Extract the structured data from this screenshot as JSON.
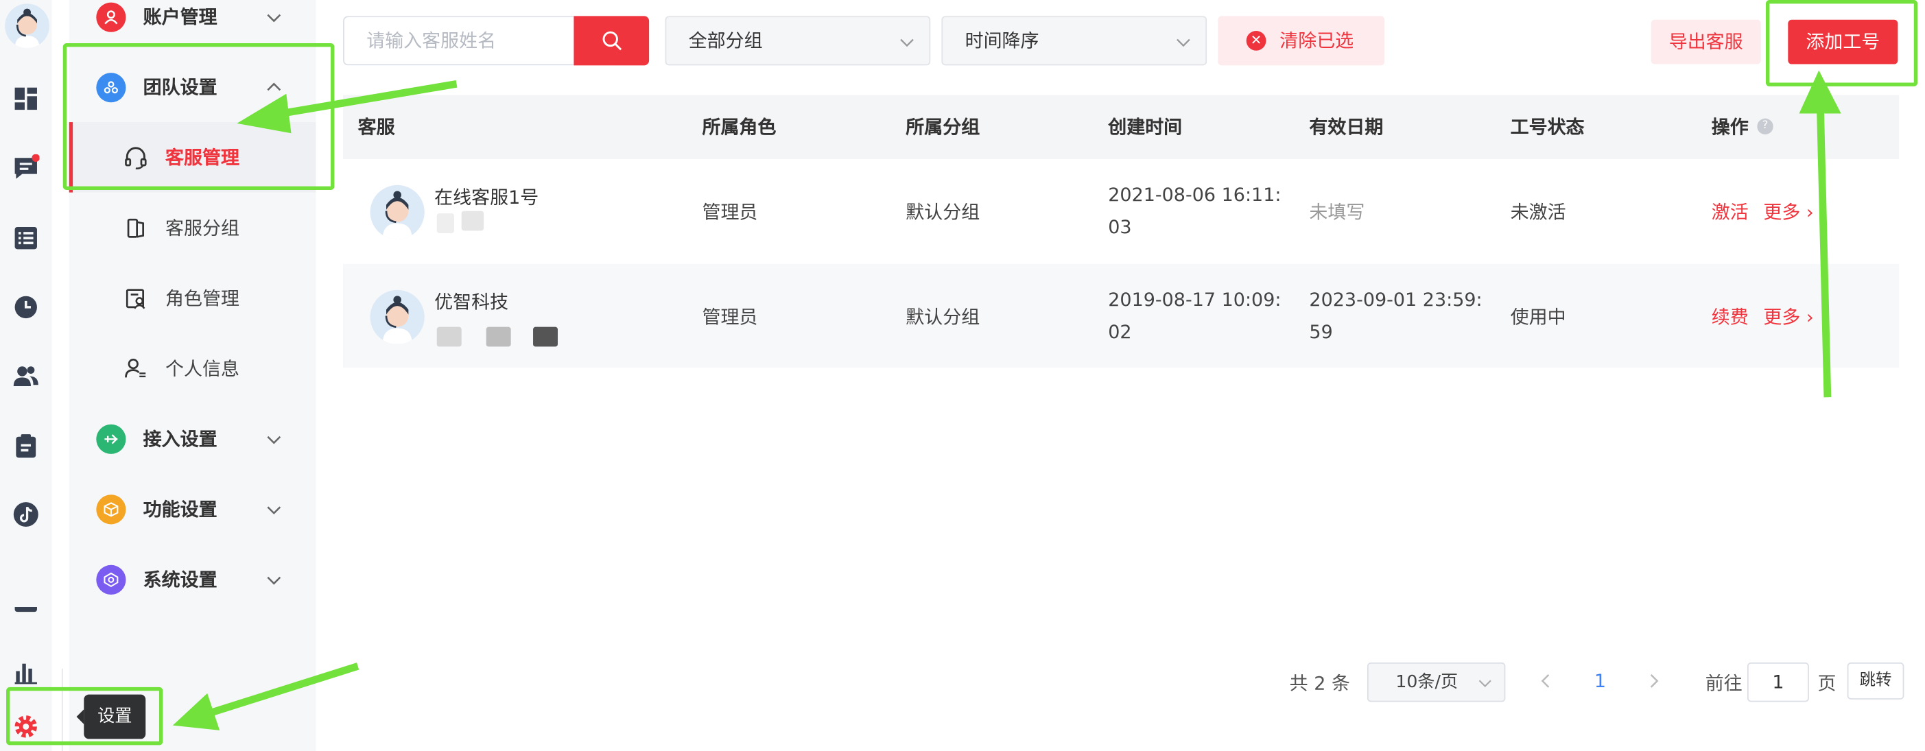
{
  "rail": {
    "icons": [
      "avatar",
      "dashboard-icon",
      "chat-icon",
      "list-icon",
      "clock-icon",
      "users-icon",
      "clipboard-icon",
      "tiktok-icon",
      "chart-icon",
      "settings-icon"
    ],
    "tooltip": "设置"
  },
  "menu": {
    "items": [
      {
        "label": "账户管理",
        "icon": "user-icon",
        "color": "#f0343d"
      },
      {
        "label": "团队设置",
        "icon": "team-icon",
        "color": "#3b8cf0"
      },
      {
        "label": "接入设置",
        "icon": "access-icon",
        "color": "#2bb673"
      },
      {
        "label": "功能设置",
        "icon": "function-icon",
        "color": "#f5a524"
      },
      {
        "label": "系统设置",
        "icon": "system-icon",
        "color": "#7b5cf0"
      }
    ],
    "sub": [
      {
        "label": "客服管理",
        "icon": "headset-icon"
      },
      {
        "label": "客服分组",
        "icon": "group-icon"
      },
      {
        "label": "角色管理",
        "icon": "role-icon"
      },
      {
        "label": "个人信息",
        "icon": "person-icon"
      }
    ]
  },
  "toolbar": {
    "search_placeholder": "请输入客服姓名",
    "group_select": "全部分组",
    "sort_select": "时间降序",
    "clear": "清除已选",
    "export": "导出客服",
    "add": "添加工号"
  },
  "table": {
    "headers": [
      "客服",
      "所属角色",
      "所属分组",
      "创建时间",
      "有效日期",
      "工号状态",
      "操作"
    ],
    "rows": [
      {
        "name": "在线客服1号",
        "role": "管理员",
        "group": "默认分组",
        "created": [
          "2021-08-06 16:11:",
          "03"
        ],
        "valid": [
          "未填写"
        ],
        "status": "未激活",
        "action": "激活",
        "more": "更多"
      },
      {
        "name": "优智科技",
        "role": "管理员",
        "group": "默认分组",
        "created": [
          "2019-08-17 10:09:",
          "02"
        ],
        "valid": [
          "2023-09-01 23:59:",
          "59"
        ],
        "status": "使用中",
        "action": "续费",
        "more": "更多"
      }
    ]
  },
  "pagination": {
    "total": "共 2 条",
    "page_size": "10条/页",
    "current": "1",
    "goto": "前往",
    "goto_value": "1",
    "page": "页",
    "jump": "跳转"
  },
  "colors": {
    "accent": "#f0343d",
    "highlight": "#72e13b"
  }
}
